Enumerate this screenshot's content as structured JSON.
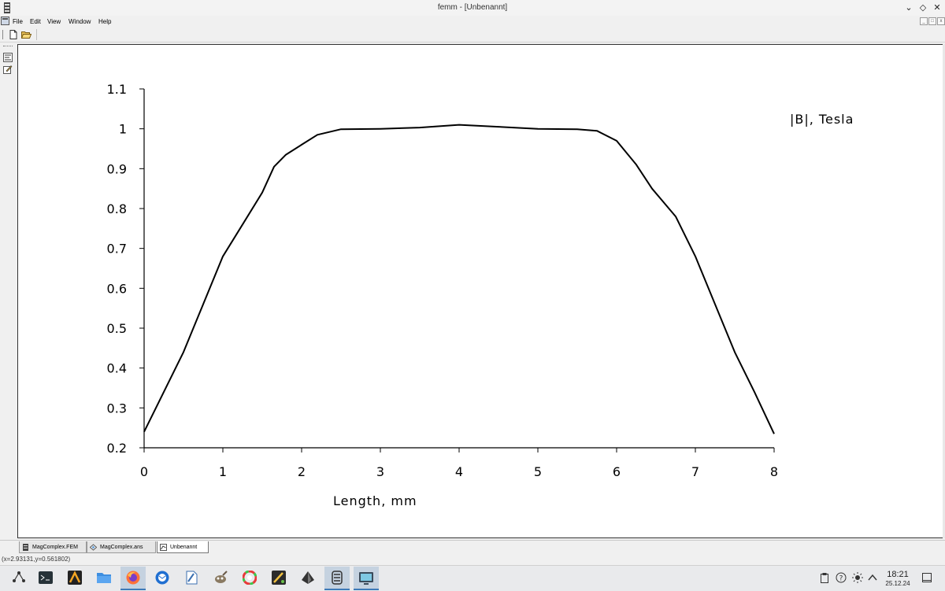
{
  "window": {
    "title": "femm - [Unbenannt]",
    "controls": [
      "chevron-down-icon",
      "diamond-icon",
      "close-icon"
    ]
  },
  "menu": {
    "items": [
      "File",
      "Edit",
      "View",
      "Window",
      "Help"
    ]
  },
  "chart_data": {
    "type": "line",
    "title": "",
    "xlabel": "Length, mm",
    "ylabel": "",
    "legend": "|B|, Tesla",
    "legend_placement": "top-right",
    "grid": false,
    "xlim": [
      0,
      8
    ],
    "ylim": [
      0.2,
      1.1
    ],
    "xticks": [
      "0",
      "1",
      "2",
      "3",
      "4",
      "5",
      "6",
      "7",
      "8"
    ],
    "yticks": [
      "0.2",
      "0.3",
      "0.4",
      "0.5",
      "0.6",
      "0.7",
      "0.8",
      "0.9",
      "1",
      "1.1"
    ],
    "series": [
      {
        "name": "|B|, Tesla",
        "x": [
          0.0,
          0.25,
          0.5,
          0.75,
          1.0,
          1.25,
          1.5,
          1.65,
          1.8,
          2.0,
          2.2,
          2.5,
          3.0,
          3.5,
          4.0,
          4.5,
          5.0,
          5.5,
          5.75,
          6.0,
          6.25,
          6.45,
          6.75,
          7.0,
          7.25,
          7.5,
          7.75,
          8.0
        ],
        "y": [
          0.24,
          0.34,
          0.44,
          0.56,
          0.68,
          0.76,
          0.84,
          0.905,
          0.935,
          0.96,
          0.985,
          0.999,
          1.0,
          1.003,
          1.01,
          1.005,
          1.0,
          0.999,
          0.995,
          0.97,
          0.91,
          0.85,
          0.78,
          0.68,
          0.56,
          0.44,
          0.34,
          0.235
        ]
      }
    ]
  },
  "tabs": [
    {
      "label": "MagComplex.FEM",
      "icon": "femm-doc-icon",
      "active": false
    },
    {
      "label": "MagComplex.ans",
      "icon": "solution-doc-icon",
      "active": false
    },
    {
      "label": "Unbenannt",
      "icon": "plot-doc-icon",
      "active": true
    }
  ],
  "status": {
    "coords": "(x=2.93131,y=0.561802)"
  },
  "taskbar": {
    "clock_time": "18:21",
    "clock_date": "25.12.24",
    "accent": "#3d7ab8"
  }
}
